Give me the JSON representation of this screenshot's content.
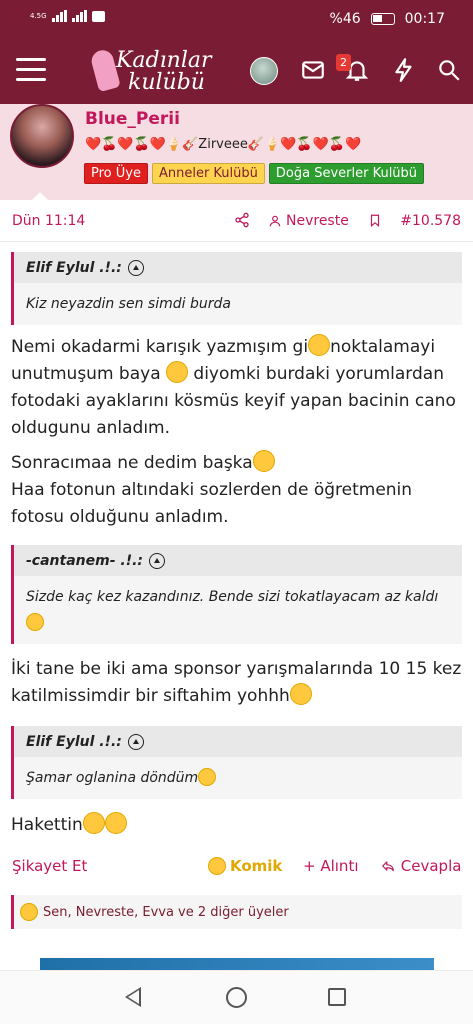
{
  "status_bar": {
    "network": "4.5G",
    "battery_percent": "%46",
    "time": "00:17"
  },
  "header": {
    "logo_line1": "Kadınlar",
    "logo_line2": "kulübü",
    "notification_count": "2",
    "icons": [
      "menu-icon",
      "avatar",
      "mail-icon",
      "bell-icon",
      "lightning-icon",
      "search-icon"
    ]
  },
  "post": {
    "username": "Blue_Perii",
    "tagline": "❤️🍒❤️🍒❤️🍦🎸Zirveee🎸🍦❤️🍒❤️🍒❤️",
    "badges": [
      "Pro Üye",
      "Anneler Kulübü",
      "Doğa Severler Kulübü"
    ],
    "date": "Dün 11:14",
    "author": "Nevreste",
    "post_number": "#10.578"
  },
  "quotes": [
    {
      "author": "Elif Eylul .!.:",
      "text": "Kiz neyazdin sen simdi burda"
    },
    {
      "author": "-cantanem- .!.:",
      "text": "Sizde kaç kez kazandınız. Bende sizi tokatlayacam az kaldı"
    },
    {
      "author": "Elif Eylul .!.:",
      "text": "Şamar oglanina döndüm"
    }
  ],
  "paragraphs": {
    "p1_a": "Nemi okadarmi karışık yazmışım gi",
    "p1_b": "noktalamayi",
    "p1_c": "unutmuşum baya ",
    "p1_d": " diyomki burdaki yorumlardan fotodaki ayaklarını kösmüs keyif yapan bacinin cano oldugunu anladım.",
    "p2_a": "Sonracımaa ne dedim başka",
    "p2_b": "Haa fotonun altındaki sozlerden de öğretmenin fotosu olduğunu anladım.",
    "p3": "İki tane be iki ama sponsor yarışmalarında 10 15 kez katilmissimdir bir siftahim yohhh",
    "p4": "Hakettin"
  },
  "actions": {
    "report": "Şikayet Et",
    "funny": "Komik",
    "quote": "+ Alıntı",
    "reply": "Cevapla"
  },
  "reactions": {
    "text": "Sen, Nevreste, Evva ve 2 diğer üyeler"
  },
  "colors": {
    "brand": "#7a1c33",
    "accent": "#c2185b",
    "profile_bg": "#f6dde3"
  }
}
